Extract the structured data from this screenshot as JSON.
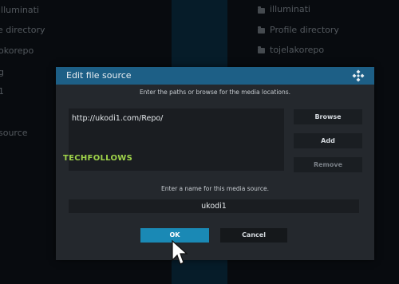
{
  "background": {
    "left_items": [
      "illuminati",
      "e directory",
      "okorepo",
      "g",
      "1",
      "source"
    ],
    "right_items": [
      "illuminati",
      "Profile directory",
      "tojelakorepo"
    ]
  },
  "dialog": {
    "title": "Edit file source",
    "paths_hint": "Enter the paths or browse for the media locations.",
    "path_value": "http://ukodi1.com/Repo/",
    "buttons": {
      "browse": "Browse",
      "add": "Add",
      "remove": "Remove"
    },
    "name_hint": "Enter a name for this media source.",
    "name_value": "ukodi1",
    "ok": "OK",
    "cancel": "Cancel"
  },
  "watermark": "TECHFOLLOWS",
  "icons": {
    "app_logo": "kodi-logo-icon",
    "folder": "folder-icon",
    "cursor": "mouse-pointer-icon"
  },
  "colors": {
    "header": "#1d5f86",
    "ok_button": "#1a89b5",
    "watermark": "#9fd34a"
  }
}
